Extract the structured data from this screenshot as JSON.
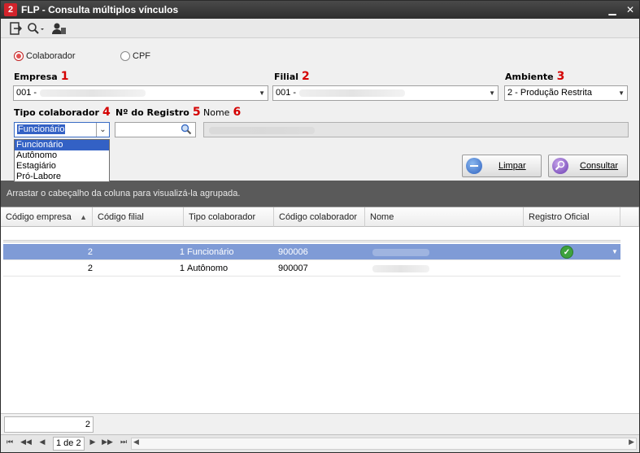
{
  "window": {
    "title": "FLP - Consulta múltiplos vínculos",
    "app_icon_glyph": "2"
  },
  "toolbar": {
    "icons": [
      "exit-icon",
      "search-icon",
      "user-card-icon"
    ]
  },
  "radio": {
    "colaborador": "Colaborador",
    "cpf": "CPF",
    "selected": "colaborador"
  },
  "fields": {
    "empresa": {
      "label": "Empresa",
      "num": "1",
      "value": "001 -"
    },
    "filial": {
      "label": "Filial",
      "num": "2",
      "value": "001 -"
    },
    "ambiente": {
      "label": "Ambiente",
      "num": "3",
      "value": "2 - Produção Restrita"
    },
    "tipo": {
      "label": "Tipo colaborador",
      "num": "4",
      "value": "Funcionário"
    },
    "registro": {
      "label": "Nº do Registro",
      "num": "5",
      "value": ""
    },
    "nome": {
      "label": "Nome",
      "num": "6",
      "value": ""
    }
  },
  "dropdown": {
    "options": [
      "Funcionário",
      "Autônomo",
      "Estagiário",
      "Pró-Labore"
    ],
    "selected_index": 0
  },
  "buttons": {
    "limpar": "Limpar",
    "consultar": "Consultar"
  },
  "grid": {
    "group_hint": "Arrastar o cabeçalho da coluna para visualizá-la agrupada.",
    "columns": [
      "Código empresa",
      "Código filial",
      "Tipo colaborador",
      "Código colaborador",
      "Nome",
      "Registro Oficial"
    ],
    "sort_indicator": "▲",
    "rows": [
      {
        "empresa": "2",
        "filial": "1",
        "tipo": "Funcionário",
        "colaborador": "900006",
        "nome": "",
        "oficial": true
      },
      {
        "empresa": "2",
        "filial": "1",
        "tipo": "Autônomo",
        "colaborador": "900007",
        "nome": "",
        "oficial": false
      }
    ]
  },
  "footer": {
    "count": "2"
  },
  "pager": {
    "text": "1 de 2"
  },
  "colors": {
    "accent": "#3361c5",
    "selected_row": "#7f9bd6",
    "required_num": "#d40000"
  }
}
